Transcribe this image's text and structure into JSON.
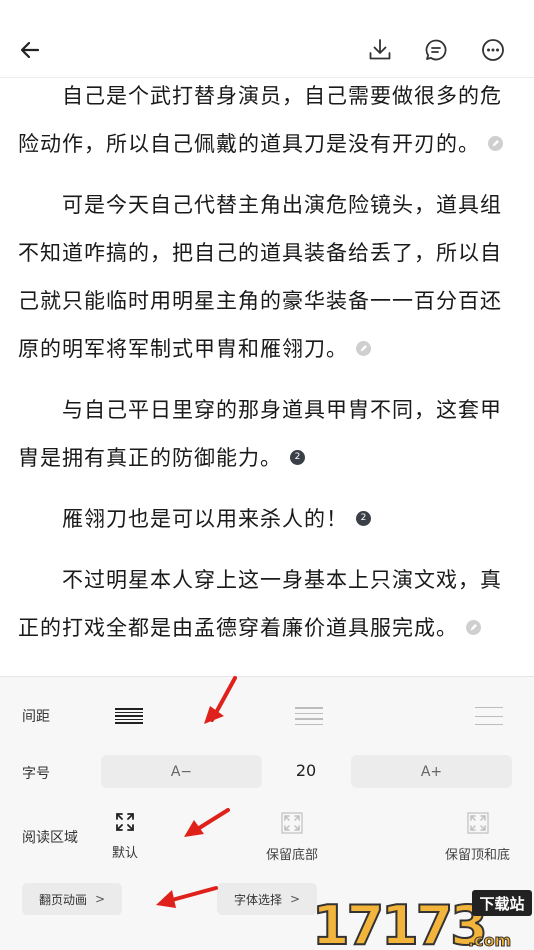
{
  "header": {
    "back_icon": "arrow-left-icon",
    "download_icon": "download-icon",
    "comment_icon": "comment-icon",
    "more_icon": "more-icon"
  },
  "content": {
    "paragraphs": [
      {
        "text": "自己是个武打替身演员，自己需要做很多的危险动作，所以自己佩戴的道具刀是没有开刃的。",
        "mark": "pen",
        "count": ""
      },
      {
        "text": "可是今天自己代替主角出演危险镜头，道具组不知道咋搞的，把自己的道具装备给丢了，所以自己就只能临时用明星主角的豪华装备一一百分百还原的明军将军制式甲胄和雁翎刀。",
        "mark": "pen",
        "count": ""
      },
      {
        "text": "与自己平日里穿的那身道具甲胄不同，这套甲胄是拥有真正的防御能力。",
        "mark": "count",
        "count": "2"
      },
      {
        "text": "雁翎刀也是可以用来杀人的！",
        "mark": "count",
        "count": "2"
      },
      {
        "text": "不过明星本人穿上这一身基本上只演文戏，真正的打戏全都是由孟德穿着廉价道具服完成。",
        "mark": "pen",
        "count": ""
      }
    ]
  },
  "settings": {
    "spacing_label": "间距",
    "font_size_label": "字号",
    "font_decrease": "A−",
    "font_size_value": "20",
    "font_increase": "A+",
    "reading_area_label": "阅读区域",
    "reading_area_options": [
      "默认",
      "保留底部",
      "保留顶和底"
    ],
    "page_animation": "翻页动画",
    "font_select": "字体选择",
    "chevron": ">"
  },
  "watermark": {
    "brand_number": "17173",
    "brand_suffix": ".com",
    "tag": "下载站"
  },
  "colors": {
    "accent_red": "#e0211b",
    "panel_bg": "#f7f7f7",
    "active_dark": "#222222",
    "inactive_gray": "#b5b5b5"
  }
}
